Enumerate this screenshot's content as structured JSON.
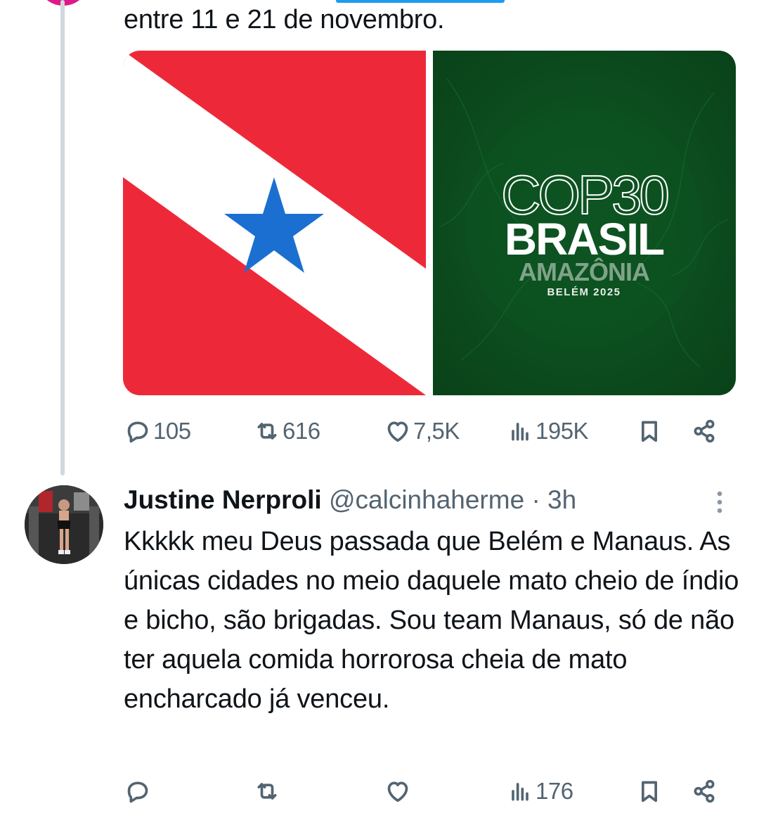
{
  "tweet": {
    "text_tail": "entre 11 e 21 de novembro.",
    "media": [
      {
        "alt": "Bandeira do Pará",
        "colors": {
          "red": "#ed2939",
          "white": "#ffffff",
          "star": "#1b6fd1"
        }
      },
      {
        "alt": "Logo COP30",
        "line1": "COP30",
        "line2": "BRASIL",
        "line3": "AMAZÔNIA",
        "line4": "BELÉM 2025",
        "background": "#0c4d1e"
      }
    ],
    "stats": {
      "replies": "105",
      "reposts": "616",
      "likes": "7,5K",
      "views": "195K"
    }
  },
  "reply": {
    "name": "Justine Nerproli",
    "handle": "@calcinhaherme",
    "separator": "·",
    "time": "3h",
    "text": "Kkkkk meu Deus passada que Belém e Manaus. As únicas cidades no meio daquele mato cheio de índio e bicho, são brigadas. Sou team Manaus, só de não ter aquela comida horrorosa cheia de mato encharcado já venceu.",
    "stats": {
      "views": "176"
    }
  },
  "colors": {
    "text": "#0f1419",
    "secondary": "#536471",
    "thread_line": "#cfd9de",
    "accent": "#1d9bf0"
  },
  "icons": [
    "reply-icon",
    "repost-icon",
    "like-icon",
    "views-icon",
    "bookmark-icon",
    "share-icon",
    "more-icon"
  ]
}
